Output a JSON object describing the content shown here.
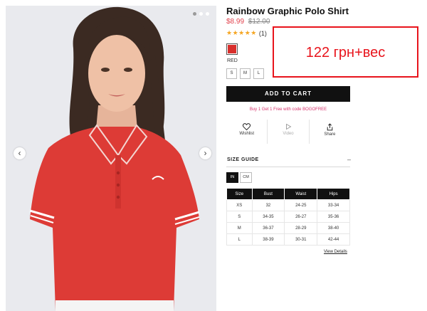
{
  "product": {
    "title": "Rainbow Graphic Polo Shirt",
    "price": "$8.99",
    "original_price": "$12.00",
    "rating_stars": "★★★★★",
    "rating_value": 5,
    "review_count": "(1)",
    "color": {
      "name": "RED",
      "hex": "#d82f2c"
    },
    "sizes": [
      "S",
      "M",
      "L"
    ]
  },
  "cart": {
    "add_label": "ADD TO CART"
  },
  "promo_text": "Buy 1 Get 1 Free with code BOGOFREE",
  "actions": [
    {
      "label": "Wishlist",
      "icon": "heart-icon"
    },
    {
      "label": "Video",
      "icon": "play-icon"
    },
    {
      "label": "Share",
      "icon": "share-icon"
    }
  ],
  "size_guide": {
    "label": "SIZE GUIDE",
    "toggle_symbol": "–",
    "units": [
      "IN",
      "CM"
    ],
    "selected_unit": "IN",
    "columns": [
      "Size",
      "Bust",
      "Waist",
      "Hips"
    ],
    "rows": [
      [
        "XS",
        "32",
        "24-25",
        "33-34"
      ],
      [
        "S",
        "34-35",
        "26-27",
        "35-36"
      ],
      [
        "M",
        "36-37",
        "28-29",
        "38-40"
      ],
      [
        "L",
        "38-39",
        "30-31",
        "42-44"
      ]
    ],
    "view_details": "View Details"
  },
  "gallery": {
    "total_images": 3,
    "active_index": 1
  },
  "annotation": {
    "text": "122 грн+вес",
    "color": "#e8141c"
  }
}
